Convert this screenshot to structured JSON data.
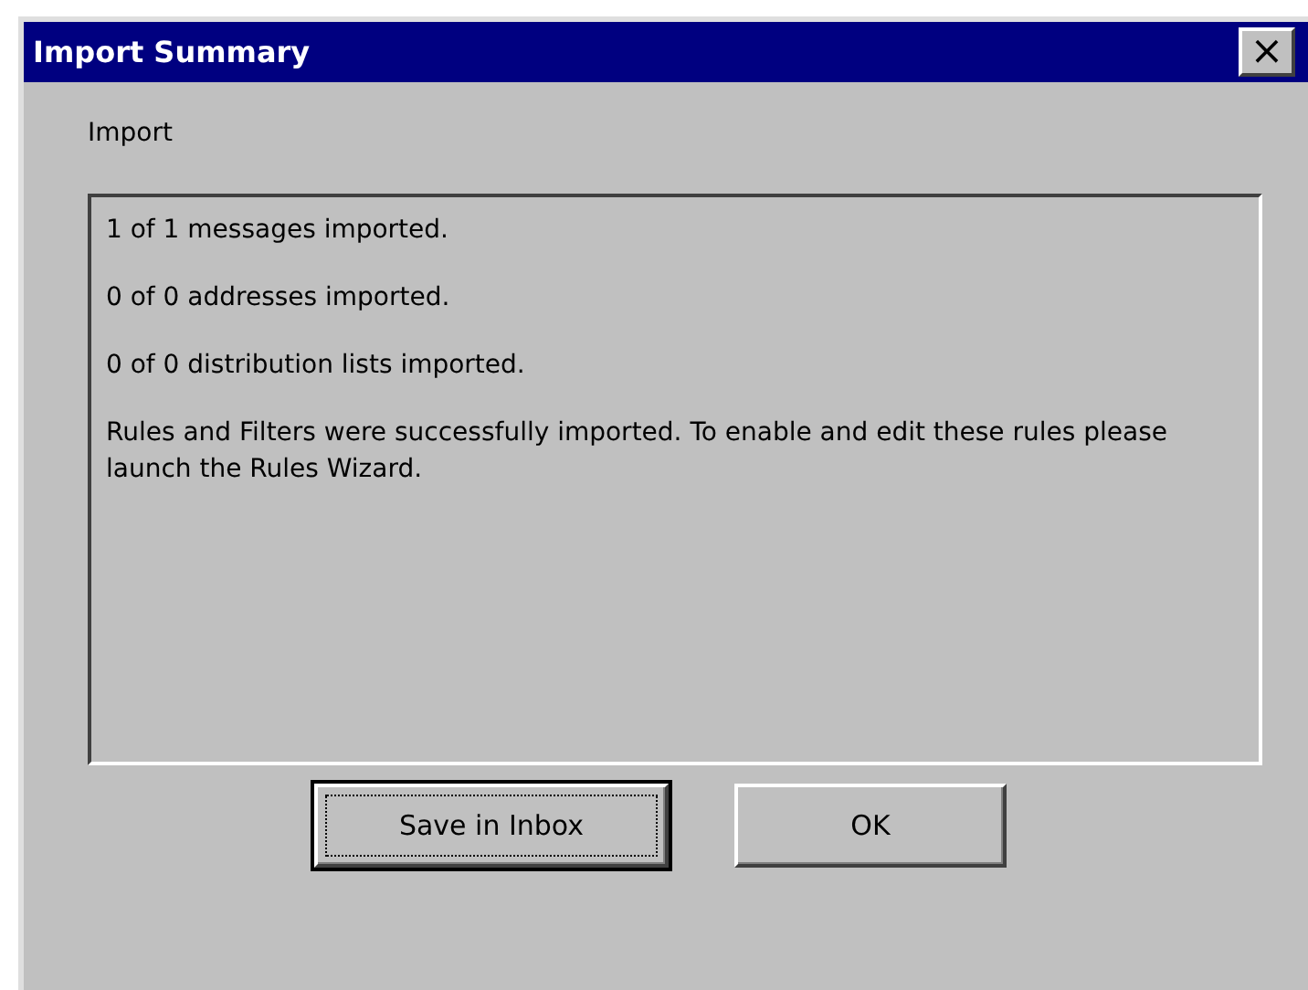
{
  "window": {
    "title": "Import Summary",
    "close": "×"
  },
  "section_label": "Import",
  "messages": [
    "1 of 1 messages imported.",
    "0 of 0 addresses imported.",
    "0 of 0 distribution lists imported.",
    "Rules and Filters were successfully imported. To enable and edit these rules please launch the Rules Wizard."
  ],
  "buttons": [
    {
      "label": "Save in Inbox",
      "focused": true
    },
    {
      "label": "OK",
      "focused": false
    }
  ]
}
